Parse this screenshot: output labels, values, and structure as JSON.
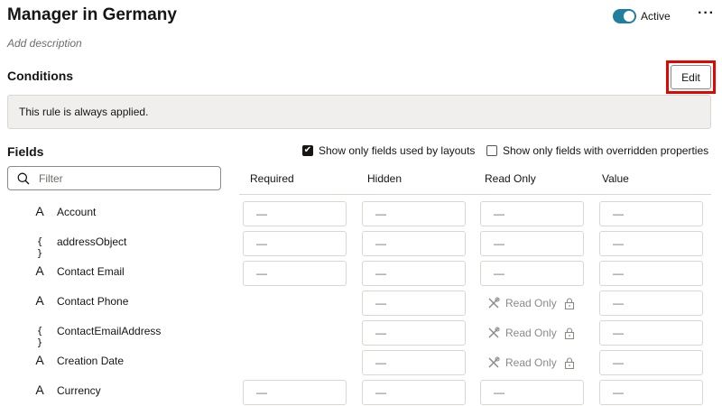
{
  "header": {
    "title": "Manager in Germany",
    "description_placeholder": "Add description",
    "toggle_label": "Active",
    "more_icon": "more-horizontal-icon"
  },
  "conditions": {
    "title": "Conditions",
    "edit_label": "Edit",
    "notice": "This rule is always applied.",
    "highlight_color": "#e10600"
  },
  "fields": {
    "title": "Fields",
    "checkbox_layouts": {
      "label": "Show only fields used by layouts",
      "checked": true
    },
    "checkbox_overridden": {
      "label": "Show only fields with overridden properties",
      "checked": false
    },
    "filter_placeholder": "Filter",
    "columns": {
      "required": "Required",
      "hidden": "Hidden",
      "read_only": "Read Only",
      "value": "Value"
    },
    "dash": "—",
    "read_only_text": "Read Only",
    "rows": [
      {
        "icon": "text-type-icon",
        "name": "Account",
        "required": "—",
        "hidden": "—",
        "read_only": "—",
        "value": "—",
        "read_only_locked": false,
        "has_required": true
      },
      {
        "icon": "object-type-icon",
        "name": "addressObject",
        "required": "—",
        "hidden": "—",
        "read_only": "—",
        "value": "—",
        "read_only_locked": false,
        "has_required": true
      },
      {
        "icon": "text-type-icon",
        "name": "Contact Email",
        "required": "—",
        "hidden": "—",
        "read_only": "—",
        "value": "—",
        "read_only_locked": false,
        "has_required": true
      },
      {
        "icon": "text-type-icon",
        "name": "Contact Phone",
        "required": "",
        "hidden": "—",
        "read_only": "Read Only",
        "value": "—",
        "read_only_locked": true,
        "has_required": false
      },
      {
        "icon": "object-type-icon",
        "name": "ContactEmailAddress",
        "required": "",
        "hidden": "—",
        "read_only": "Read Only",
        "value": "—",
        "read_only_locked": true,
        "has_required": false
      },
      {
        "icon": "text-type-icon",
        "name": "Creation Date",
        "required": "",
        "hidden": "—",
        "read_only": "Read Only",
        "value": "—",
        "read_only_locked": true,
        "has_required": false
      },
      {
        "icon": "text-type-icon",
        "name": "Currency",
        "required": "—",
        "hidden": "—",
        "read_only": "—",
        "value": "—",
        "read_only_locked": false,
        "has_required": true
      }
    ]
  },
  "colors": {
    "accent": "#227e9e",
    "border": "#dad7d3",
    "notice_bg": "#f1efed"
  }
}
